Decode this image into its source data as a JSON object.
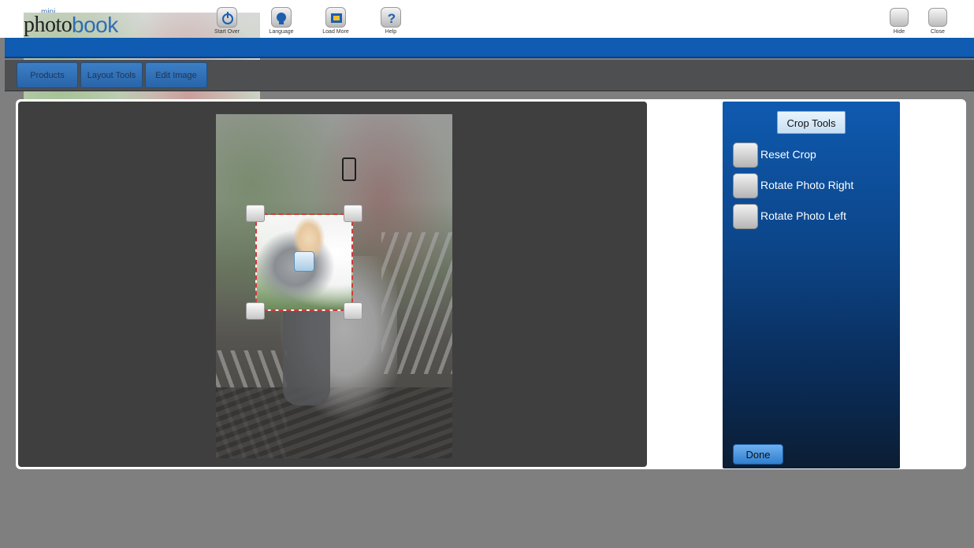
{
  "brand": {
    "mini": "mini",
    "photo": "photo",
    "book": "book"
  },
  "toolbar": {
    "start_over": "Start Over",
    "language": "Language",
    "load_more": "Load More",
    "help": "Help",
    "hide": "Hide",
    "close": "Close"
  },
  "tabs": [
    {
      "label": "Products"
    },
    {
      "label": "Layout Tools"
    },
    {
      "label": "Edit Image"
    }
  ],
  "crop_panel": {
    "title": "Crop Tools",
    "options": [
      {
        "label": "Reset Crop",
        "icon": "square-button-icon"
      },
      {
        "label": "Rotate Photo Right",
        "icon": "square-button-icon"
      },
      {
        "label": "Rotate Photo Left",
        "icon": "square-button-icon"
      }
    ],
    "done": "Done"
  },
  "colors": {
    "accent_blue": "#0f5cb2",
    "crop_border": "#d43a3a",
    "sidebar_top": "#0f5ab0",
    "sidebar_bottom": "#0b1d33",
    "canvas": "#3f3f3f",
    "background": "#7f7f7f"
  }
}
